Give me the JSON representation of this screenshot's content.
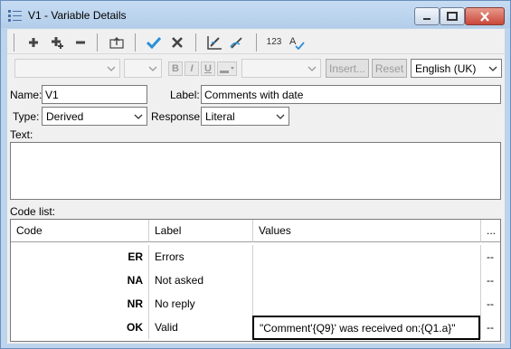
{
  "window": {
    "title": "V1 - Variable Details",
    "icon": "variable-details-icon"
  },
  "toolbar": {
    "icons": [
      "add-icon",
      "add-multiple-icon",
      "remove-icon",
      "move-up-icon",
      "ok-check-icon",
      "cancel-x-icon",
      "properties-icon",
      "clear-icon",
      "numbering-icon",
      "spell-check-icon"
    ],
    "numbering_label": "123"
  },
  "format_bar": {
    "bold": "B",
    "italic": "I",
    "underline": "U",
    "insert_label": "Insert...",
    "reset_label": "Reset",
    "language": "English (UK)"
  },
  "form": {
    "name_label": "Name:",
    "name_value": "V1",
    "label_label": "Label:",
    "label_value": "Comments with date",
    "type_label": "Type:",
    "type_value": "Derived",
    "response_label": "Response:",
    "response_value": "Literal",
    "text_label": "Text:",
    "codelist_label": "Code list:"
  },
  "grid": {
    "headers": [
      "Code",
      "Label",
      "Values",
      "..."
    ],
    "rows": [
      {
        "code": "ER",
        "label": "Errors",
        "values": "",
        "more": "--"
      },
      {
        "code": "NA",
        "label": "Not asked",
        "values": "",
        "more": "--"
      },
      {
        "code": "NR",
        "label": "No reply",
        "values": "",
        "more": "--"
      },
      {
        "code": "OK",
        "label": "Valid",
        "values": "\"Comment'{Q9}' was received on:{Q1.a}\"",
        "more": "--"
      }
    ]
  }
}
